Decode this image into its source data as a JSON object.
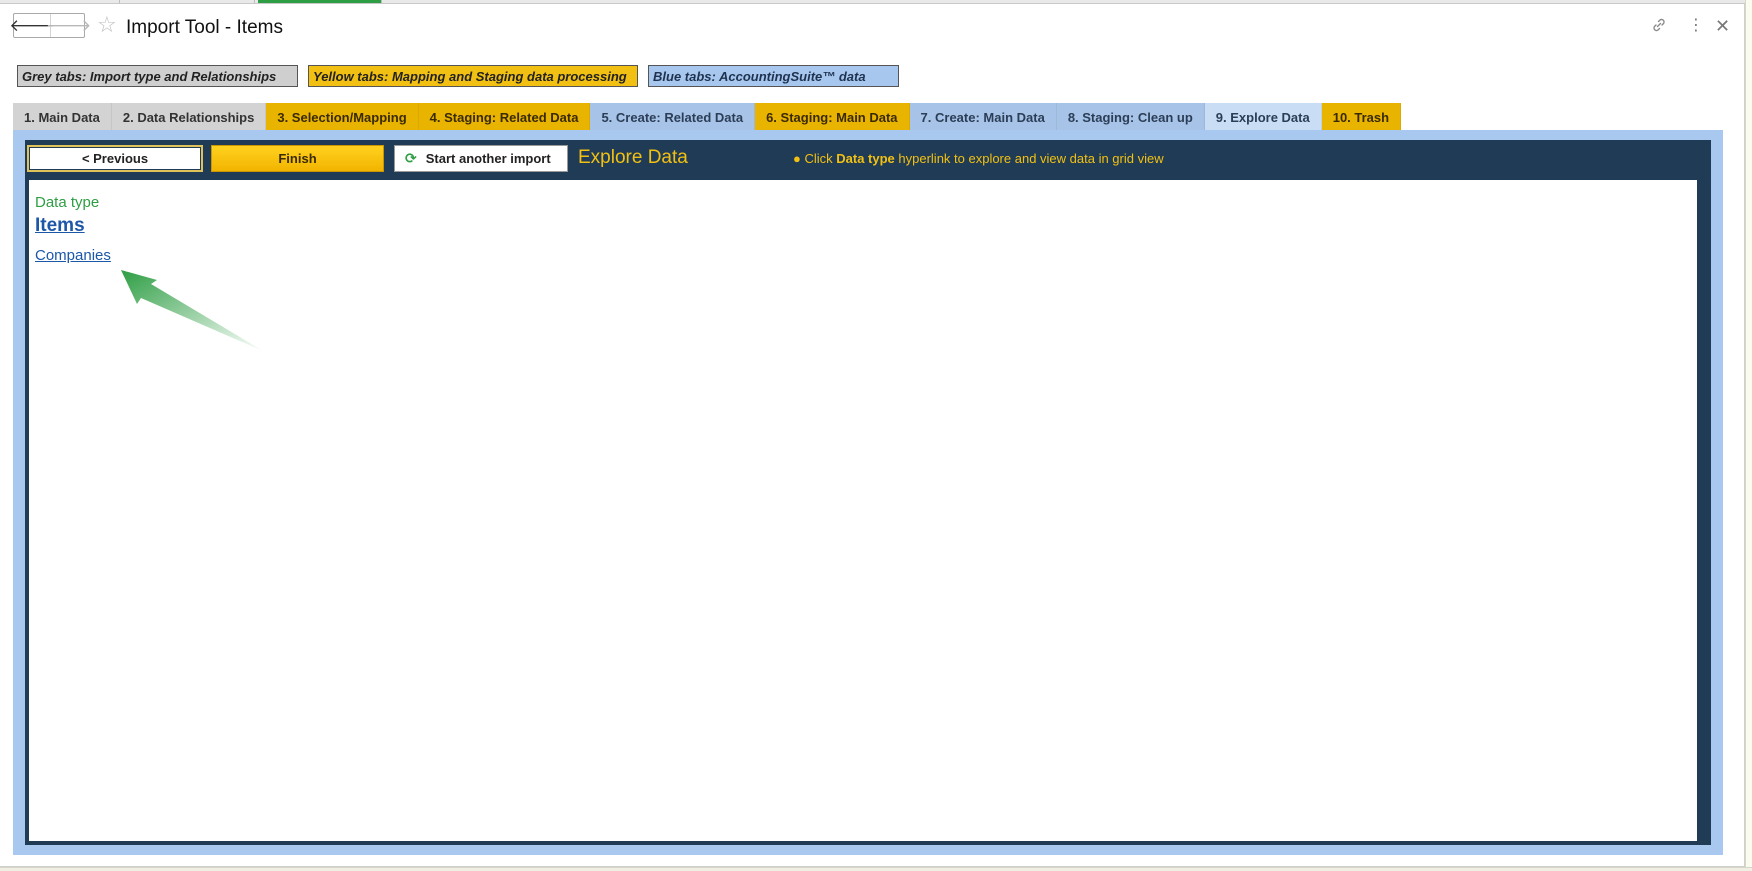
{
  "window": {
    "title": "Import Tool - Items",
    "back_icon": "arrow-left-icon",
    "forward_icon": "arrow-right-icon",
    "favorite_icon": "star-icon",
    "link_icon": "link-icon",
    "more_icon": "more-vertical-icon",
    "close_icon": "close-icon"
  },
  "legend": {
    "grey": "Grey tabs: Import type and Relationships",
    "yellow": "Yellow tabs: Mapping and Staging data processing",
    "blue": "Blue tabs: AccountingSuite™ data"
  },
  "tabs": [
    {
      "label": "1. Main Data",
      "group": "grey"
    },
    {
      "label": "2. Data Relationships",
      "group": "grey"
    },
    {
      "label": "3. Selection/Mapping",
      "group": "yellow"
    },
    {
      "label": "4. Staging: Related Data",
      "group": "yellow"
    },
    {
      "label": "5. Create: Related Data",
      "group": "blue"
    },
    {
      "label": "6. Staging: Main Data",
      "group": "yellow"
    },
    {
      "label": "7. Create: Main Data",
      "group": "blue"
    },
    {
      "label": "8. Staging: Clean up",
      "group": "blue"
    },
    {
      "label": "9. Explore Data",
      "group": "blue",
      "active": true
    },
    {
      "label": "10. Trash",
      "group": "yellow"
    }
  ],
  "toolbar": {
    "previous_label": "< Previous",
    "finish_label": "Finish",
    "another_label": "Start another import",
    "panel_title": "Explore Data",
    "hint_prefix": "● Click ",
    "hint_bold": "Data type",
    "hint_suffix": " hyperlink to explore and view data in grid view"
  },
  "content": {
    "data_type_label": "Data type",
    "items_link": "Items",
    "companies_link": "Companies"
  },
  "colors": {
    "panel_blue": "#a8c8f0",
    "navy": "#1f3b55",
    "accent_yellow": "#f2c012",
    "link_blue": "#1c57a8",
    "green": "#2e9e44"
  }
}
